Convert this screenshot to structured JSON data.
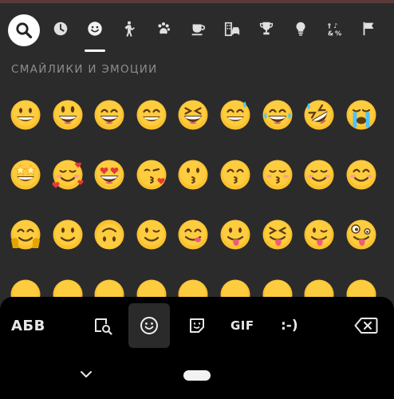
{
  "colors": {
    "emoji_face": "#fbc02d",
    "emoji_face_light": "#ffd54f",
    "emoji_outline": "#e6a400",
    "tab_icon": "#e0e0e0",
    "panel_bg": "#2b2b2b",
    "bar_bg": "#000000"
  },
  "tabs": [
    {
      "name": "search",
      "icon": "search-icon"
    },
    {
      "name": "recent",
      "icon": "clock-icon"
    },
    {
      "name": "smileys",
      "icon": "smiley-icon",
      "active": true
    },
    {
      "name": "people",
      "icon": "person-icon"
    },
    {
      "name": "animals",
      "icon": "paw-icon"
    },
    {
      "name": "food",
      "icon": "cup-icon"
    },
    {
      "name": "travel",
      "icon": "building-car-icon"
    },
    {
      "name": "activities",
      "icon": "trophy-icon"
    },
    {
      "name": "objects",
      "icon": "bulb-icon"
    },
    {
      "name": "symbols",
      "icon": "symbols-icon"
    },
    {
      "name": "flags",
      "icon": "flag-icon"
    }
  ],
  "section": {
    "title": "СМАЙЛИКИ И ЭМОЦИИ"
  },
  "emojis": [
    [
      "grin",
      "smiley",
      "smile",
      "beam",
      "laughing",
      "sweat-smile",
      "joy",
      "rofl",
      "sob"
    ],
    [
      "star-struck",
      "hearts-face",
      "heart-eyes",
      "kiss-heart",
      "kissing",
      "kiss-smile-eyes",
      "kiss-closed-eyes",
      "relaxed",
      "blush"
    ],
    [
      "hug",
      "slight-smile",
      "upside-down",
      "wink",
      "yum",
      "tongue",
      "squint-tongue",
      "wink-tongue",
      "zany"
    ]
  ],
  "bottom_bar": {
    "abc_label": "АБВ",
    "gif_label": "GIF",
    "emoticon_label": ":-)",
    "icons": [
      "sticker-search-icon",
      "emoji-icon",
      "sticker-icon",
      "backspace-icon"
    ]
  },
  "nav": {
    "icons": [
      "chevron-down-icon",
      "home-pill"
    ]
  }
}
